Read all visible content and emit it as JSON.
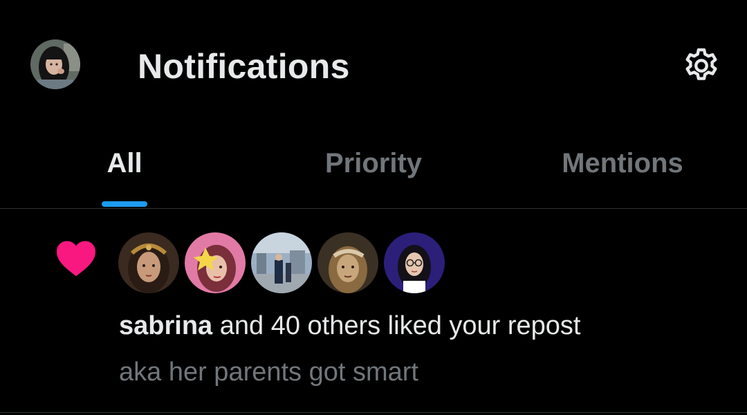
{
  "header": {
    "title": "Notifications",
    "avatar_icon": "profile-avatar",
    "settings_icon": "gear-icon"
  },
  "tabs": [
    {
      "label": "All",
      "active": true
    },
    {
      "label": "Priority",
      "active": false
    },
    {
      "label": "Mentions",
      "active": false
    }
  ],
  "notification": {
    "type_icon": "heart-icon",
    "user_name": "sabrina",
    "action_text": " and 40 others liked your repost",
    "post_excerpt": "aka her parents got smart",
    "avatar_count_shown": 5
  },
  "colors": {
    "background": "#000000",
    "text_primary": "#e7e9ea",
    "text_secondary": "#71767b",
    "accent": "#1d9bf0",
    "like": "#f91880",
    "divider": "#2f3336"
  }
}
